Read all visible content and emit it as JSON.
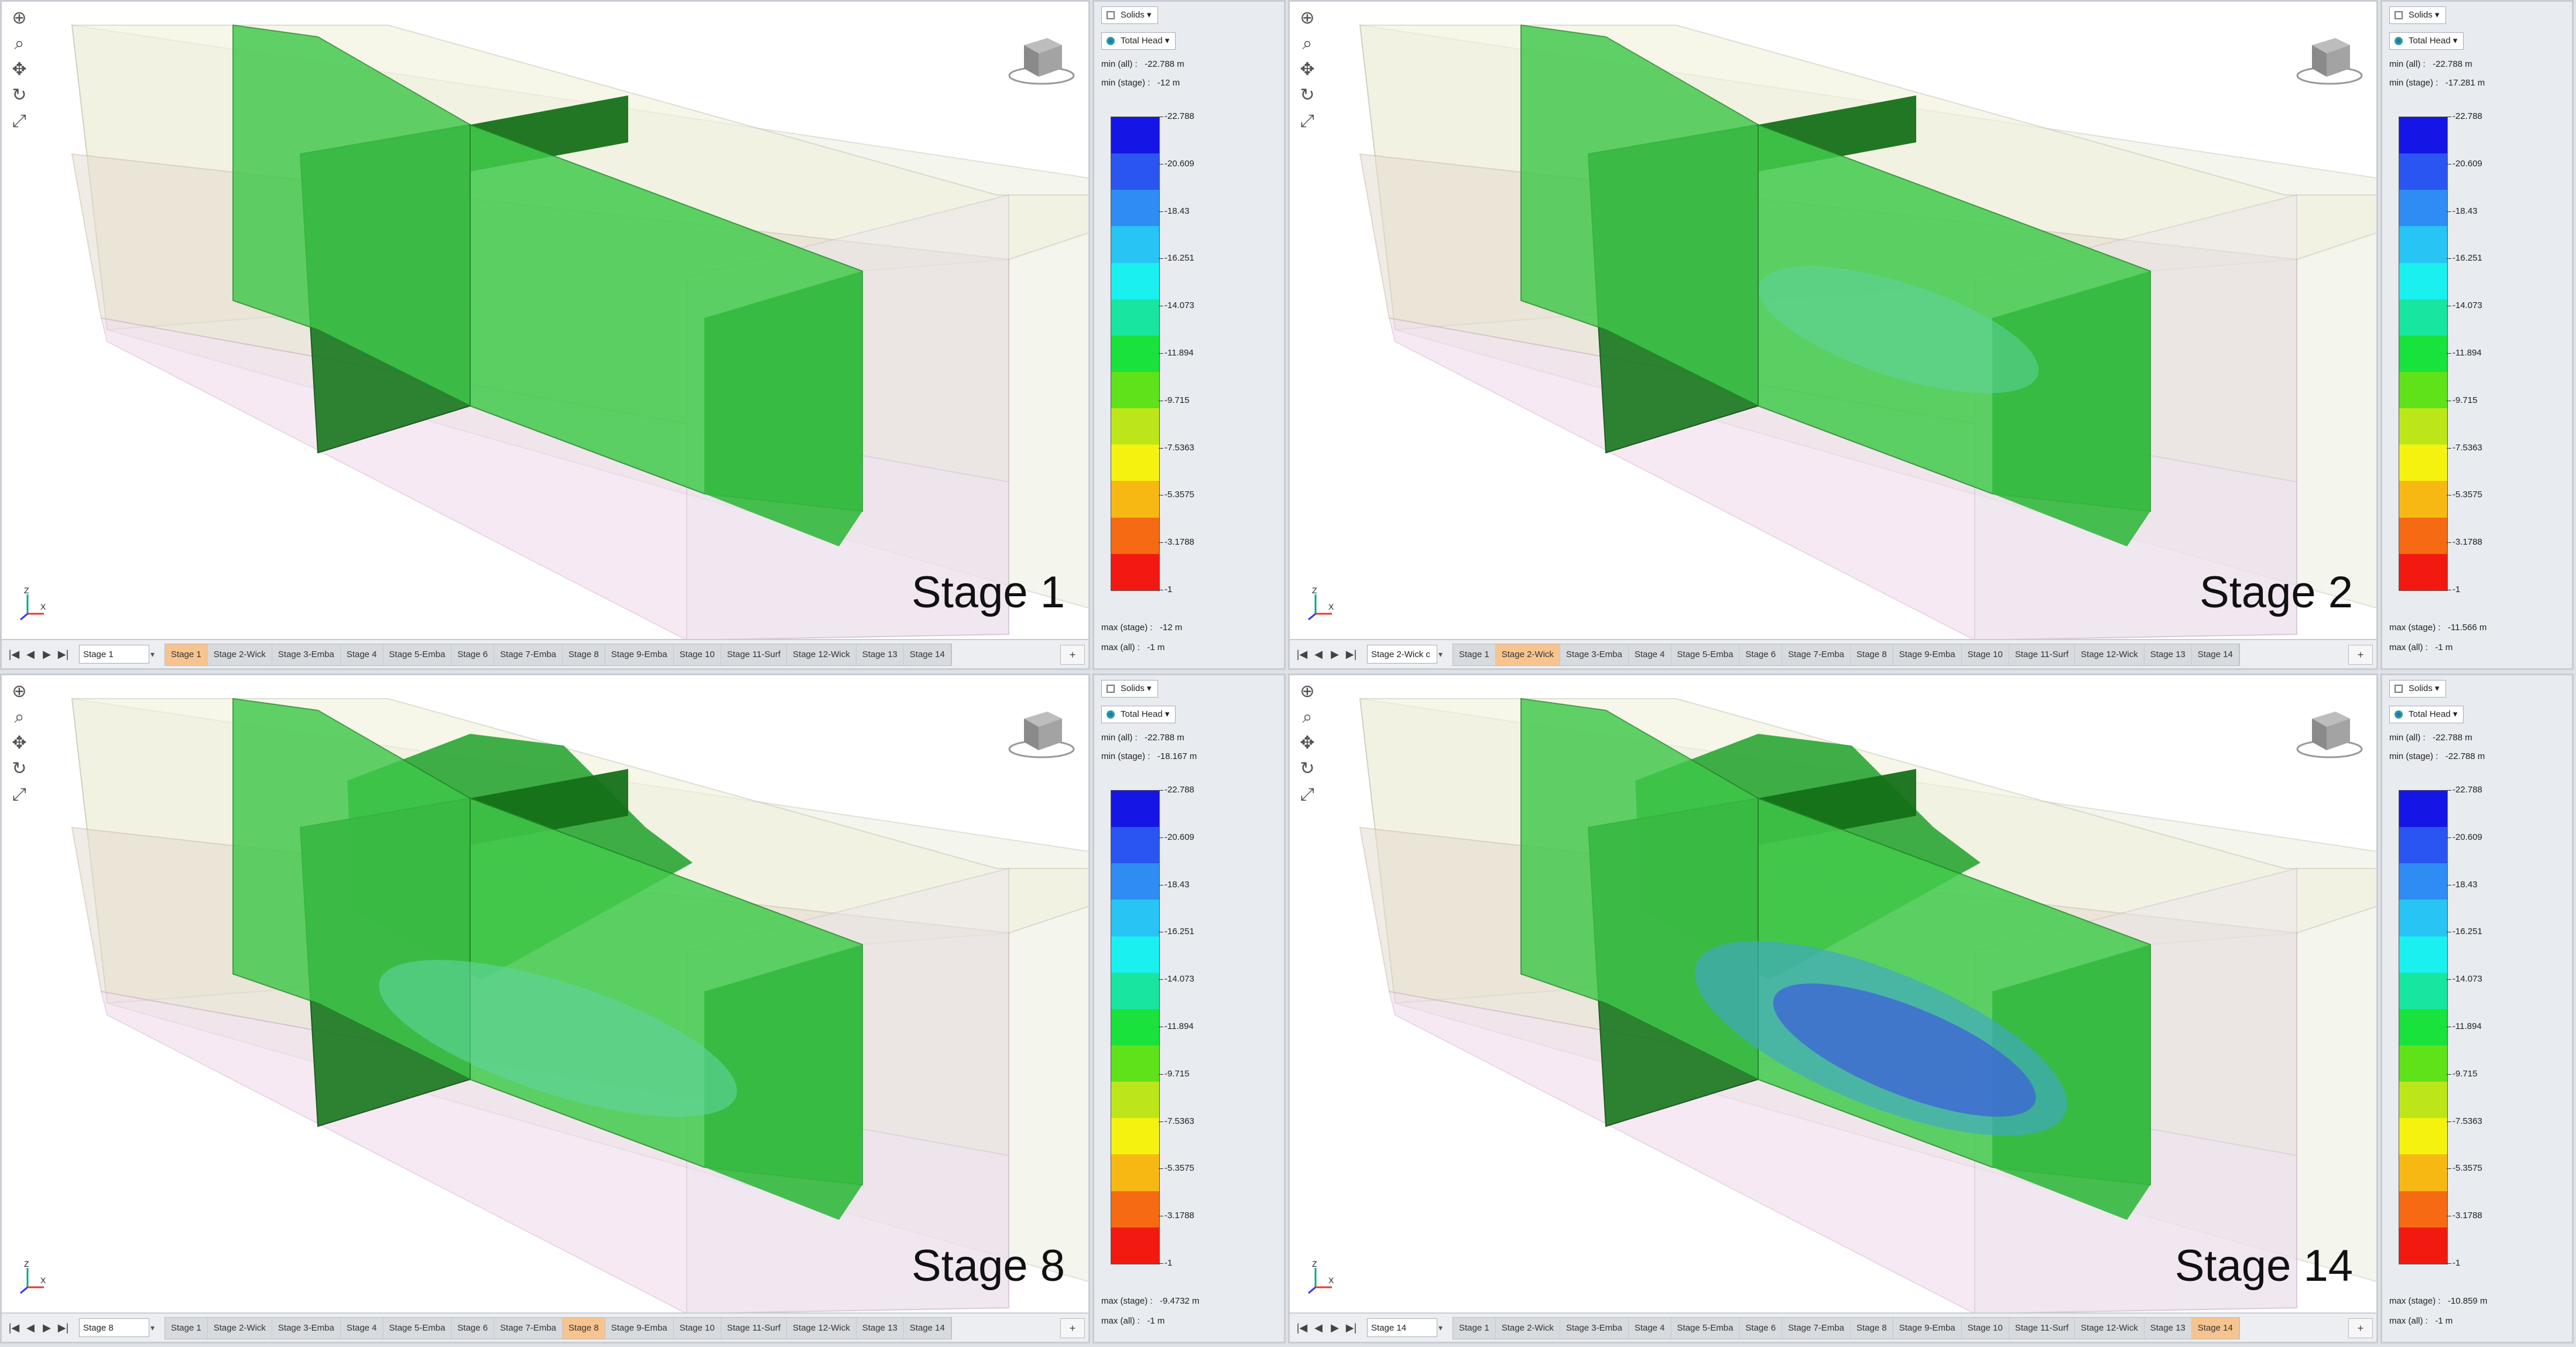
{
  "panels": [
    {
      "stage_label": "Stage 1",
      "current_stage": "Stage 1",
      "active_tab": 0,
      "solids_label": "Solids",
      "contour_label": "Total Head",
      "min_all": "min (all) :   -22.788 m",
      "min_stage": "min (stage) :   -12 m",
      "max_stage": "max (stage) :   -12 m",
      "max_all": "max (all) :   -1 m",
      "variant": 1
    },
    {
      "stage_label": "Stage 2",
      "current_stage": "Stage 2-Wick c",
      "active_tab": 1,
      "solids_label": "Solids",
      "contour_label": "Total Head",
      "min_all": "min (all) :   -22.788 m",
      "min_stage": "min (stage) :   -17.281 m",
      "max_stage": "max (stage) :   -11.566 m",
      "max_all": "max (all) :   -1 m",
      "variant": 2
    },
    {
      "stage_label": "Stage 8",
      "current_stage": "Stage 8",
      "active_tab": 7,
      "solids_label": "Solids",
      "contour_label": "Total Head",
      "min_all": "min (all) :   -22.788 m",
      "min_stage": "min (stage) :   -18.167 m",
      "max_stage": "max (stage) :   -9.4732 m",
      "max_all": "max (all) :   -1 m",
      "variant": 3
    },
    {
      "stage_label": "Stage 14",
      "current_stage": "Stage 14",
      "active_tab": 13,
      "solids_label": "Solids",
      "contour_label": "Total Head",
      "min_all": "min (all) :   -22.788 m",
      "min_stage": "min (stage) :   -22.788 m",
      "max_stage": "max (stage) :   -10.859 m",
      "max_all": "max (all) :   -1 m",
      "variant": 4
    }
  ],
  "stage_tabs": [
    "Stage 1",
    "Stage 2-Wick",
    "Stage 3-Emba",
    "Stage 4",
    "Stage 5-Emba",
    "Stage 6",
    "Stage 7-Emba",
    "Stage 8",
    "Stage 9-Emba",
    "Stage 10",
    "Stage 11-Surf",
    "Stage 12-Wick",
    "Stage 13",
    "Stage 14"
  ],
  "legend_ticks": [
    "-22.788",
    "-20.609",
    "-18.43",
    "-16.251",
    "-14.073",
    "-11.894",
    "-9.715",
    "-7.5363",
    "-5.3575",
    "-3.1788",
    "-1"
  ],
  "legend_colors": [
    "#1515e6",
    "#2a55f0",
    "#2f8cf2",
    "#27c4f4",
    "#19f0ef",
    "#18e6a0",
    "#19e23c",
    "#5fe21a",
    "#bde61a",
    "#f5f20f",
    "#f7b814",
    "#f56a12",
    "#f21a10"
  ],
  "nav_buttons": [
    "|◀",
    "◀",
    "▶",
    "▶|"
  ],
  "plus_label": "+",
  "nav_icons": [
    "zoom-window-icon",
    "zoom-icon",
    "pan-icon",
    "rotate-icon",
    "fit-icon"
  ]
}
